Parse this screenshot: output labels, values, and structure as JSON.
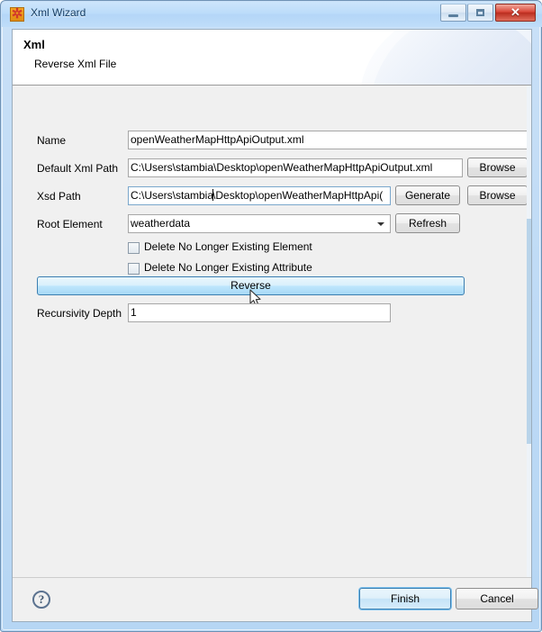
{
  "window": {
    "title": "Xml Wizard",
    "icon": "stambia-xml-icon",
    "controls": {
      "minimize": "Minimize",
      "maximize": "Maximize",
      "close": "Close",
      "close_glyph": "✕"
    }
  },
  "header": {
    "title": "Xml",
    "subtitle": "Reverse Xml File"
  },
  "form": {
    "name": {
      "label": "Name",
      "value": "openWeatherMapHttpApiOutput.xml",
      "placeholder": ""
    },
    "default_xml_path": {
      "label": "Default Xml Path",
      "value": "C:\\Users\\stambia\\Desktop\\openWeatherMapHttpApiOutput.xml",
      "placeholder": "",
      "browse_label": "Browse"
    },
    "xsd_path": {
      "label": "Xsd Path",
      "value_before_caret": "C:\\Users\\stambia",
      "value_after_caret": "\\Desktop\\openWeatherMapHttpApi(",
      "full_value": "C:\\Users\\stambia\\Desktop\\openWeatherMapHttpApiOutput.xsd",
      "generate_label": "Generate",
      "browse_label": "Browse"
    },
    "root_element": {
      "label": "Root Element",
      "value": "weatherdata",
      "options": [
        "weatherdata"
      ],
      "refresh_label": "Refresh"
    },
    "delete_element": {
      "label": "Delete No Longer Existing Element",
      "checked": false
    },
    "delete_attribute": {
      "label": "Delete No Longer Existing Attribute",
      "checked": false
    },
    "reverse": {
      "label": "Reverse",
      "state": "hover"
    },
    "recursivity_depth": {
      "label": "Recursivity Depth",
      "value": "1",
      "placeholder": ""
    }
  },
  "bottom": {
    "help": "?",
    "finish_label": "Finish",
    "cancel_label": "Cancel"
  },
  "colors": {
    "titlebar": "#bcdcfa",
    "client_bg": "#f0f0f0",
    "accent_blue": "#3c7fb1",
    "close_red": "#d9483a",
    "scrollbar_thumb": "#b9d4ea"
  }
}
